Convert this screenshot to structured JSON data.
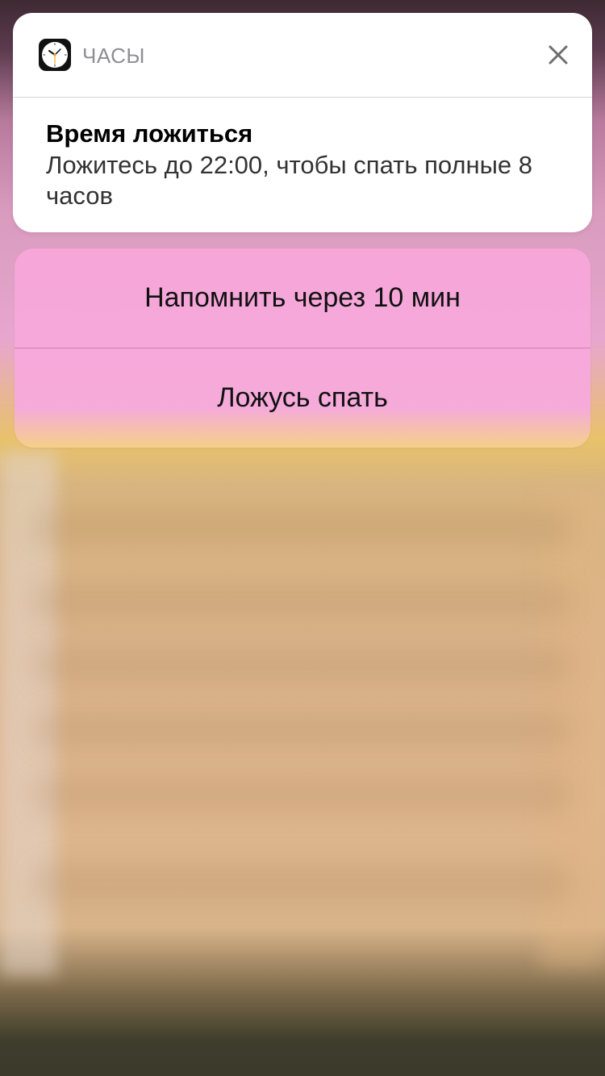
{
  "notification": {
    "app_name": "ЧАСЫ",
    "app_icon": "clock-icon",
    "close_icon": "close-icon",
    "title": "Время ложиться",
    "message": "Ложитесь до 22:00, чтобы спать полные 8 часов"
  },
  "actions": [
    {
      "label": "Напомнить через 10 мин"
    },
    {
      "label": "Ложусь спать"
    }
  ],
  "colors": {
    "card_background": "#ffffff",
    "actions_background": "#f7a6d8",
    "app_name": "#8e8e93",
    "clock_hand_accent": "#f5a623"
  }
}
